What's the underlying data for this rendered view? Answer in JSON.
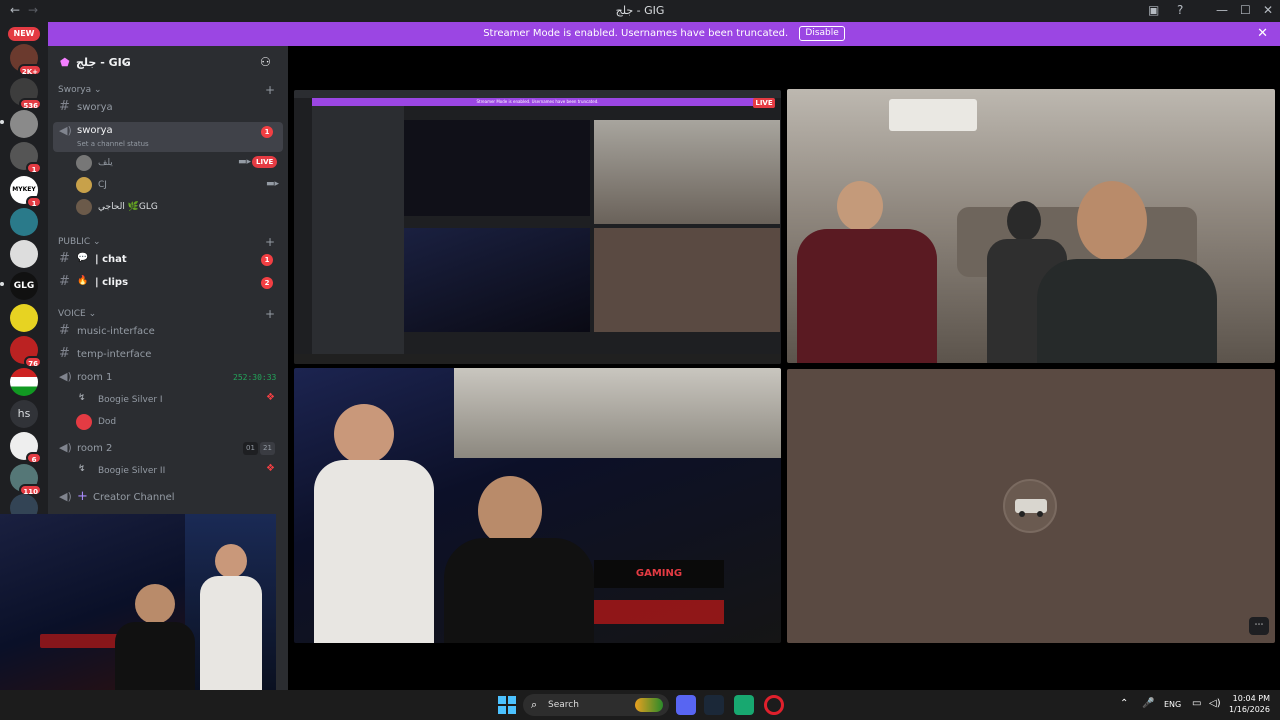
{
  "window": {
    "title": "جلج - GIG",
    "back_icon": "←",
    "forward_icon": "→"
  },
  "banner": {
    "message": "Streamer Mode is enabled. Usernames have been truncated.",
    "disable_label": "Disable"
  },
  "rail": {
    "new_badge": "NEW",
    "badges": [
      "2K+",
      "536",
      "1",
      "1",
      "76",
      "6",
      "110"
    ],
    "server_labels": [
      "MYKEY",
      "GLG",
      "hs"
    ]
  },
  "server": {
    "name": "جلج - GIG",
    "categories": {
      "sworya": "Sworya",
      "public": "PUBLIC",
      "voice": "VOICE"
    },
    "sworya_text": "sworya",
    "sworya_voice": "sworya",
    "sworya_voice_badge": "1",
    "sworya_status": "Set a channel status",
    "sworya_users": [
      {
        "name": "يلف",
        "live": "LIVE"
      },
      {
        "name": "CJ"
      },
      {
        "name": "الحاجي 🌿GLG"
      }
    ],
    "chat": {
      "name": "| chat",
      "badge": "1"
    },
    "clips": {
      "name": "| clips",
      "badge": "2"
    },
    "music_interface": "music-interface",
    "temp_interface": "temp-interface",
    "room1": {
      "name": "room 1",
      "timer": "252:30:33"
    },
    "room1_users": [
      "Boogie Silver I",
      "Dod"
    ],
    "room2": {
      "name": "room 2",
      "count_a": "01",
      "count_b": "21"
    },
    "room2_users": [
      "Boogie Silver II"
    ],
    "creator_channel": "Creator Channel"
  },
  "stream": {
    "inner_banner": "Streamer Mode is enabled. Usernames have been truncated.",
    "inner_live": "LIVE",
    "neon_sign": "GAMING"
  },
  "taskbar": {
    "search_placeholder": "Search",
    "lang": "ENG",
    "time": "10:04 PM",
    "date": "1/16/2026"
  },
  "colors": {
    "brand_purple": "#9b46e3",
    "live_red": "#e43b43",
    "voice_green": "#23a55a",
    "tile_brown": "#5a4a42"
  }
}
